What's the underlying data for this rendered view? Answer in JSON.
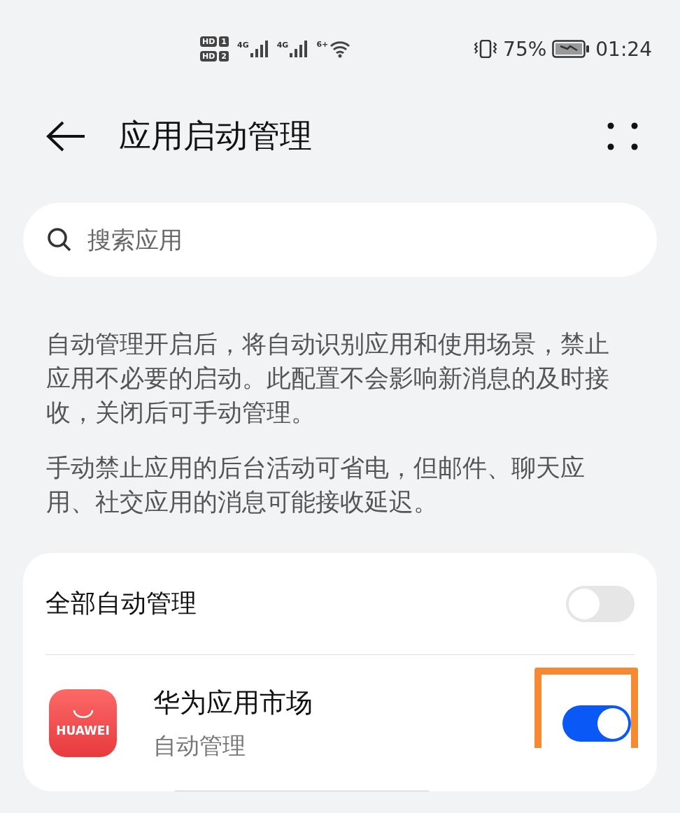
{
  "status_bar": {
    "sims": [
      {
        "label": "HD",
        "slot": "1"
      },
      {
        "label": "HD",
        "slot": "2"
      }
    ],
    "networks": [
      "4G",
      "4G"
    ],
    "wifi_label": "6+",
    "battery_percent": "75%",
    "time": "01:24"
  },
  "header": {
    "title": "应用启动管理"
  },
  "search": {
    "placeholder": "搜索应用"
  },
  "descriptions": [
    "自动管理开启后，将自动识别应用和使用场景，禁止应用不必要的启动。此配置不会影响新消息的及时接收，关闭后可手动管理。",
    "手动禁止应用的后台活动可省电，但邮件、聊天应用、社交应用的消息可能接收延迟。"
  ],
  "master": {
    "label": "全部自动管理",
    "on": false
  },
  "apps": [
    {
      "icon_label": "HUAWEI",
      "name": "华为应用市场",
      "status": "自动管理",
      "on": true,
      "highlighted": true
    }
  ]
}
